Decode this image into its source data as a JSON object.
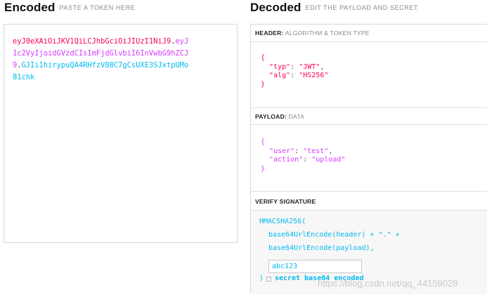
{
  "encoded": {
    "title": "Encoded",
    "subtitle": "PASTE A TOKEN HERE",
    "token_lines": [
      {
        "header": "eyJ0eXAiOiJKV1QiLCJhbGciOiJIUzI1NiJ9",
        "dot1": ".",
        "payload": "eyJ"
      },
      {
        "payload": "1c2VyIjoidGVzdCIsImFjdGlvbiI6InVwbG9hZCJ"
      },
      {
        "payload": "9",
        "dot2": ".",
        "signature": "GJIi1hirypuQA4RHfzV08C7gCsUXE3SJxtpUMo"
      },
      {
        "signature": "81chk"
      }
    ]
  },
  "decoded": {
    "title": "Decoded",
    "subtitle": "EDIT THE PAYLOAD AND SECRET",
    "header_section": {
      "label_bold": "HEADER:",
      "label_rest": "ALGORITHM & TOKEN TYPE",
      "json": {
        "typ": "JWT",
        "alg": "HS256"
      }
    },
    "payload_section": {
      "label_bold": "PAYLOAD:",
      "label_rest": "DATA",
      "json": {
        "user": "test",
        "action": "upload"
      }
    },
    "verify_section": {
      "label": "VERIFY SIGNATURE",
      "line1": "HMACSHA256(",
      "line2": "base64UrlEncode(header) + \".\" +",
      "line3": "base64UrlEncode(payload),",
      "secret_value": "abc123",
      "close": ")",
      "checkbox_label": "secret base64 encoded"
    }
  },
  "watermark": "https://blog.csdn.net/qq_44159028",
  "colors": {
    "header": "#fb015b",
    "payload": "#d63aff",
    "signature": "#00b9f1"
  }
}
